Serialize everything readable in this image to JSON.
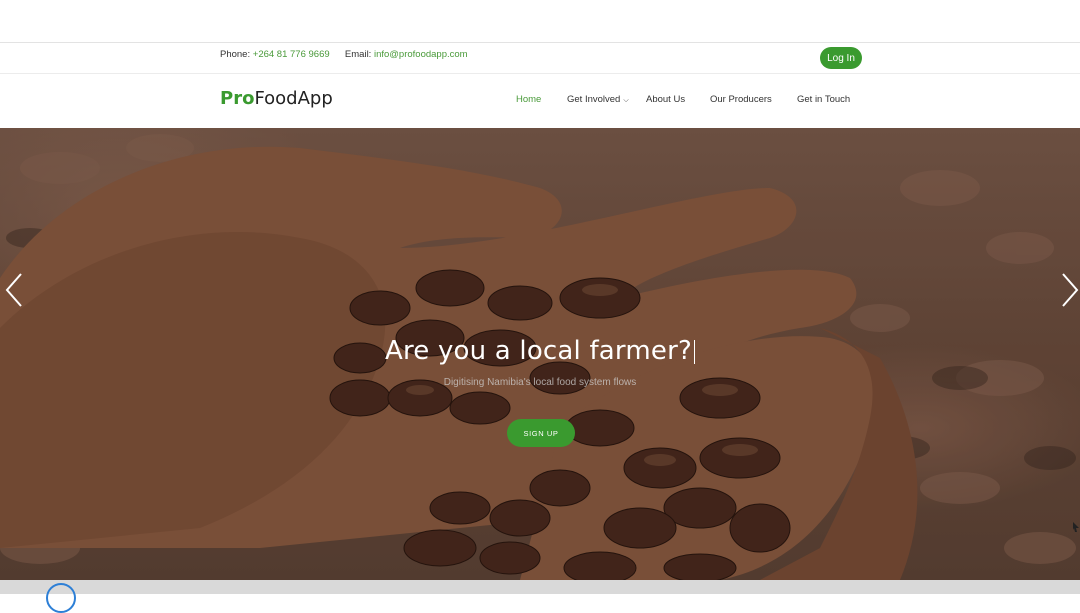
{
  "topbar": {
    "phone_label": "Phone:",
    "phone_value": "+264 81 776 9669",
    "email_label": "Email:",
    "email_value": "info@profoodapp.com",
    "login_label": "Log In"
  },
  "navbar": {
    "logo_part1": "Pro",
    "logo_part2": "FoodApp",
    "items": [
      {
        "label": "Home",
        "active": true
      },
      {
        "label": "Get Involved",
        "has_dropdown": true
      },
      {
        "label": "About Us"
      },
      {
        "label": "Our Producers"
      },
      {
        "label": "Get in Touch"
      }
    ]
  },
  "hero": {
    "title": "Are you a local farmer?",
    "subtitle": "Digitising Namibia's local food system flows",
    "cta_label": "SIGN UP",
    "prev_icon": "chevron-left-icon",
    "next_icon": "chevron-right-icon"
  },
  "colors": {
    "brand_green": "#3a9a2f",
    "link_green": "#4a9a3a"
  }
}
